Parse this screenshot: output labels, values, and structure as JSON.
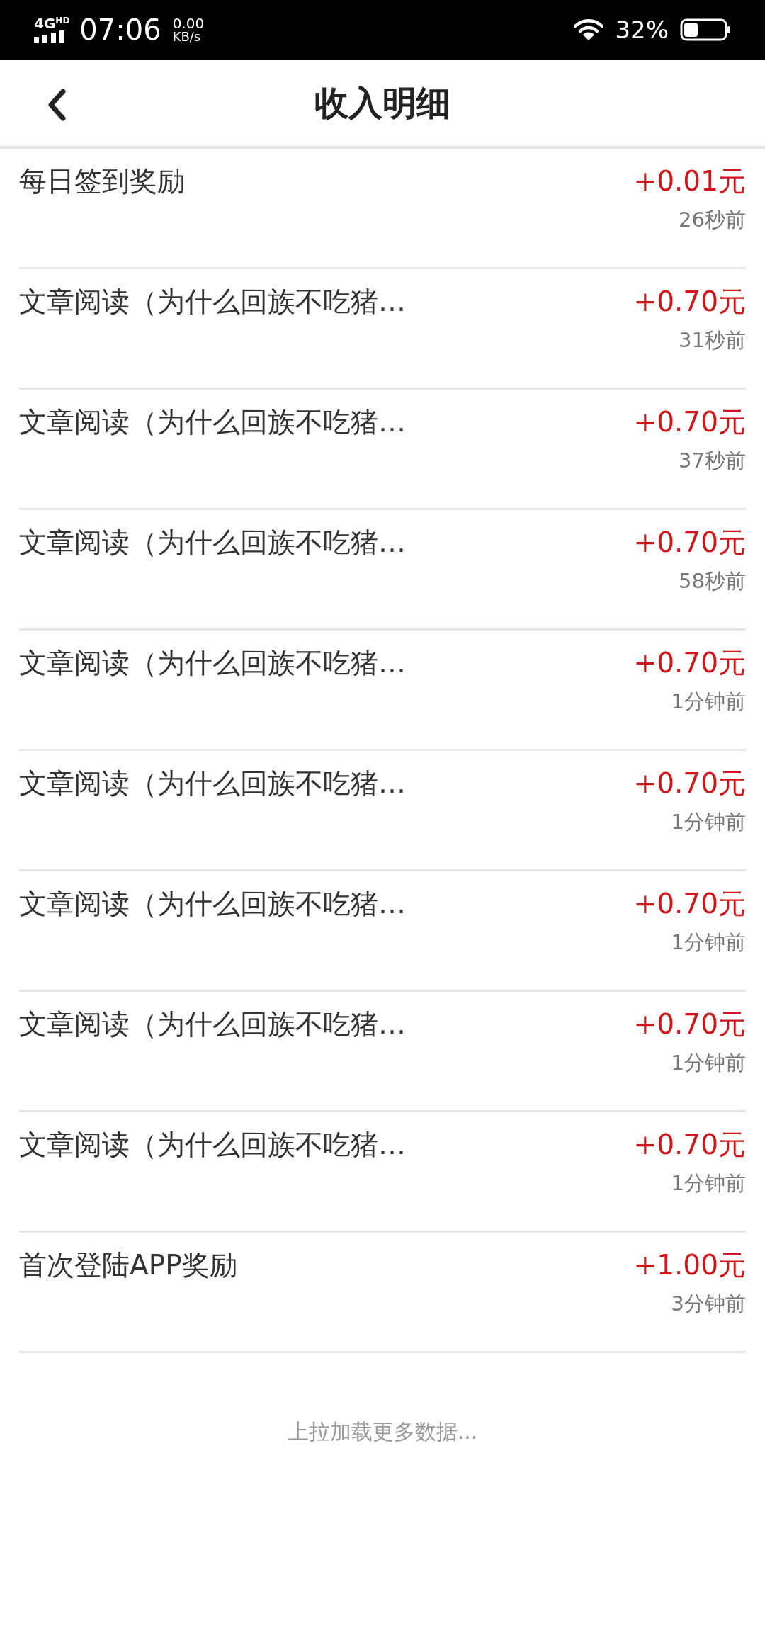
{
  "status_bar": {
    "network": "4G",
    "network_badge": "HD",
    "time": "07:06",
    "speed_value": "0.00",
    "speed_unit": "KB/s",
    "battery": "32%"
  },
  "header": {
    "title": "收入明细"
  },
  "records": [
    {
      "title": "每日签到奖励",
      "amount": "+0.01元",
      "time": "26秒前"
    },
    {
      "title": "文章阅读（为什么回族不吃猪…",
      "amount": "+0.70元",
      "time": "31秒前"
    },
    {
      "title": "文章阅读（为什么回族不吃猪…",
      "amount": "+0.70元",
      "time": "37秒前"
    },
    {
      "title": "文章阅读（为什么回族不吃猪…",
      "amount": "+0.70元",
      "time": "58秒前"
    },
    {
      "title": "文章阅读（为什么回族不吃猪…",
      "amount": "+0.70元",
      "time": "1分钟前"
    },
    {
      "title": "文章阅读（为什么回族不吃猪…",
      "amount": "+0.70元",
      "time": "1分钟前"
    },
    {
      "title": "文章阅读（为什么回族不吃猪…",
      "amount": "+0.70元",
      "time": "1分钟前"
    },
    {
      "title": "文章阅读（为什么回族不吃猪…",
      "amount": "+0.70元",
      "time": "1分钟前"
    },
    {
      "title": "文章阅读（为什么回族不吃猪…",
      "amount": "+0.70元",
      "time": "1分钟前"
    },
    {
      "title": "首次登陆APP奖励",
      "amount": "+1.00元",
      "time": "3分钟前"
    }
  ],
  "load_more": "上拉加载更多数据..."
}
